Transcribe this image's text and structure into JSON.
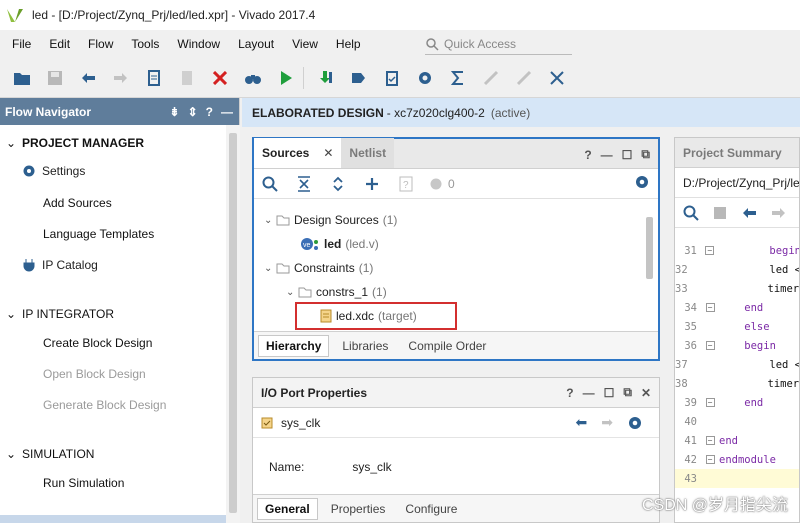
{
  "window": {
    "title": "led - [D:/Project/Zynq_Prj/led/led.xpr] - Vivado 2017.4"
  },
  "menu": [
    "File",
    "Edit",
    "Flow",
    "Tools",
    "Window",
    "Layout",
    "View",
    "Help"
  ],
  "quick_access": {
    "placeholder": "Quick Access"
  },
  "toolbar_icons": [
    "open-project-icon",
    "save-icon",
    "undo-icon",
    "redo-icon",
    "copy-icon",
    "paste-icon",
    "delete-icon",
    "binoculars-icon",
    "run-icon",
    "download-icon",
    "step-icon",
    "report-icon",
    "settings-icon",
    "sigma-icon",
    "disabled-tool-icon",
    "disabled-tool-icon",
    "scissors-icon"
  ],
  "navigator": {
    "title": "Flow Navigator",
    "sections": [
      {
        "label": "PROJECT MANAGER",
        "items": [
          "Settings",
          "Add Sources",
          "Language Templates",
          "IP Catalog"
        ]
      },
      {
        "label": "IP INTEGRATOR",
        "items": [
          "Create Block Design",
          "Open Block Design",
          "Generate Block Design"
        ]
      },
      {
        "label": "SIMULATION",
        "items": [
          "Run Simulation"
        ]
      }
    ]
  },
  "header": {
    "title": "ELABORATED DESIGN",
    "part": " - xc7z020clg400-2",
    "state": "(active)"
  },
  "sources": {
    "tab_active": "Sources",
    "tab_inactive": "Netlist",
    "unsaved_count": "0",
    "tree": {
      "design_sources": {
        "label": "Design Sources",
        "count": "(1)"
      },
      "led": {
        "label": "led",
        "file": "(led.v)"
      },
      "constraints": {
        "label": "Constraints",
        "count": "(1)"
      },
      "constrs_1": {
        "label": "constrs_1",
        "count": "(1)"
      },
      "led_xdc": {
        "label": "led.xdc",
        "tag": "(target)"
      }
    },
    "bottom_tabs": [
      "Hierarchy",
      "Libraries",
      "Compile Order"
    ]
  },
  "io_ports": {
    "title": "I/O Port Properties",
    "port": "sys_clk",
    "name_label": "Name:",
    "name_value": "sys_clk",
    "bottom_tabs": [
      "General",
      "Properties",
      "Configure"
    ]
  },
  "summary": {
    "title": "Project Summary",
    "path": "D:/Project/Zynq_Prj/le",
    "code": [
      {
        "ln": "31",
        "text": "        begin",
        "fold": true
      },
      {
        "ln": "32",
        "text": "            led <",
        "fold": false
      },
      {
        "ln": "33",
        "text": "            timer_",
        "fold": false
      },
      {
        "ln": "34",
        "text": "    end",
        "fold": true
      },
      {
        "ln": "35",
        "text": "    else",
        "fold": false
      },
      {
        "ln": "36",
        "text": "    begin",
        "fold": true
      },
      {
        "ln": "37",
        "text": "            led <",
        "fold": false
      },
      {
        "ln": "38",
        "text": "            timer_",
        "fold": false
      },
      {
        "ln": "39",
        "text": "    end",
        "fold": true
      },
      {
        "ln": "40",
        "text": "",
        "fold": false
      },
      {
        "ln": "41",
        "text": "end",
        "fold": true
      },
      {
        "ln": "42",
        "text": "endmodule",
        "fold": true
      },
      {
        "ln": "43",
        "text": "",
        "fold": false
      }
    ]
  },
  "watermark": "CSDN @岁月指尖流"
}
